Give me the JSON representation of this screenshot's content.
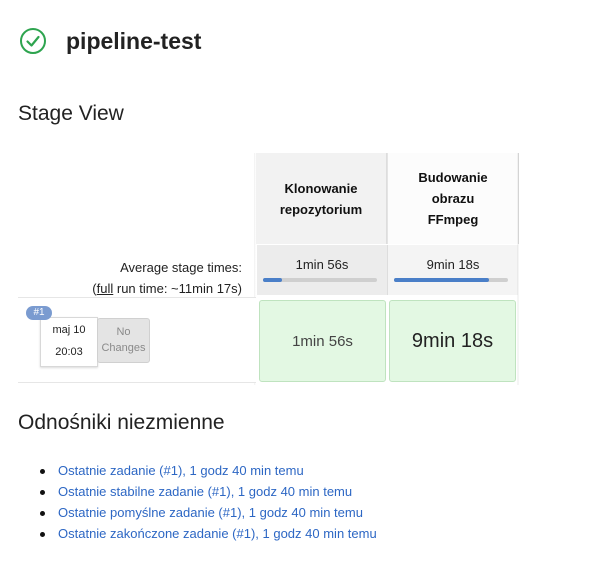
{
  "header": {
    "title": "pipeline-test",
    "status_icon": "check-circle-icon",
    "status_color": "#2ea44f"
  },
  "stage_view": {
    "title": "Stage View",
    "stages": [
      {
        "name": "Klonowanie repozytorium",
        "avg_time": "1min 56s",
        "avg_progress": 0.17
      },
      {
        "name": "Budowanie obrazu FFmpeg",
        "avg_time": "9min 18s",
        "avg_progress": 0.83
      }
    ],
    "avg_label": "Average stage times:",
    "full_prefix": "(",
    "full_link": "full",
    "full_suffix": " run time: ~11min 17s)",
    "run": {
      "badge": "#1",
      "date": "maj 10",
      "time": "20:03",
      "changes": "No Changes",
      "stage_times": [
        "1min 56s",
        "9min 18s"
      ]
    },
    "success_color": "#e3f8e3"
  },
  "permalinks": {
    "title": "Odnośniki niezmienne",
    "items": [
      "Ostatnie zadanie (#1), 1 godz 40 min temu",
      "Ostatnie stabilne zadanie (#1), 1 godz 40 min temu",
      "Ostatnie pomyślne zadanie (#1), 1 godz 40 min temu",
      "Ostatnie zakończone zadanie (#1), 1 godz 40 min temu"
    ]
  }
}
